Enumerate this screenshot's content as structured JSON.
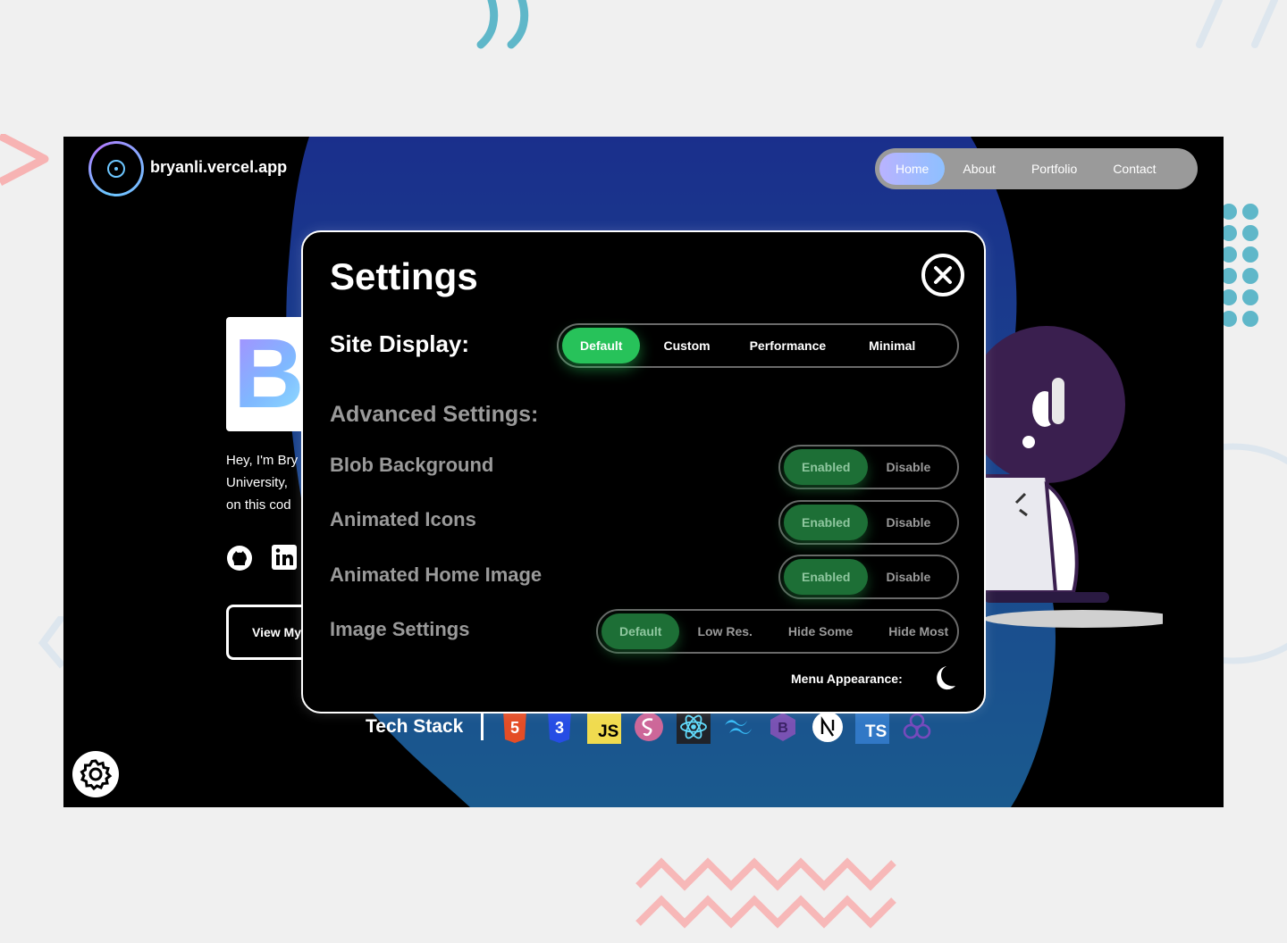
{
  "site": {
    "name": "bryanli.vercel.app"
  },
  "nav": {
    "items": [
      "Home",
      "About",
      "Portfolio",
      "Contact"
    ],
    "active": "Home"
  },
  "hero": {
    "initial": "B",
    "intro_lines": [
      "Hey, I'm Bry",
      "University,",
      "on this cod"
    ],
    "button_label": "View My"
  },
  "tech": {
    "title": "Tech Stack",
    "icons": [
      "html5-icon",
      "css3-icon",
      "javascript-icon",
      "sass-icon",
      "react-icon",
      "tailwind-icon",
      "bootstrap-icon",
      "nextjs-icon",
      "typescript-icon",
      "redux-icon"
    ]
  },
  "settings": {
    "title": "Settings",
    "site_display": {
      "label": "Site Display:",
      "options": [
        "Default",
        "Custom",
        "Performance",
        "Minimal"
      ],
      "selected": "Default"
    },
    "advanced_title": "Advanced Settings:",
    "blob_background": {
      "label": "Blob Background",
      "on": "Enabled",
      "off": "Disable"
    },
    "animated_icons": {
      "label": "Animated Icons",
      "on": "Enabled",
      "off": "Disable"
    },
    "animated_home_image": {
      "label": "Animated Home Image",
      "on": "Enabled",
      "off": "Disable"
    },
    "image_settings": {
      "label": "Image Settings",
      "options": [
        "Default",
        "Low Res.",
        "Hide Some",
        "Hide Most"
      ],
      "selected": "Default"
    },
    "menu_appearance": {
      "label": "Menu Appearance:",
      "icon": "moon-icon"
    }
  },
  "colors": {
    "accent_green": "#27c25a",
    "blob_blue": "#1a3a8f",
    "nav_bg": "#9a9a9a"
  }
}
